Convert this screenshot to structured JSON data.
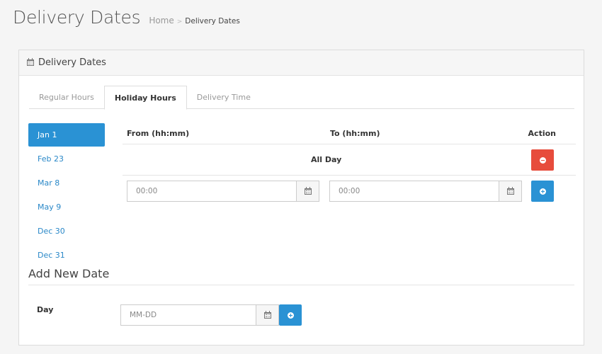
{
  "header": {
    "title": "Delivery Dates",
    "breadcrumb": {
      "home": "Home",
      "separator": ">",
      "current": "Delivery Dates"
    }
  },
  "panel": {
    "title": "Delivery Dates"
  },
  "tabs": [
    {
      "label": "Regular Hours",
      "active": false
    },
    {
      "label": "Holiday Hours",
      "active": true
    },
    {
      "label": "Delivery Time",
      "active": false
    }
  ],
  "dates": [
    "Jan 1",
    "Feb 23",
    "Mar 8",
    "May 9",
    "Dec 30",
    "Dec 31"
  ],
  "selected_date": "Jan 1",
  "hours_table": {
    "headers": {
      "from": "From (hh:mm)",
      "to": "To (hh:mm)",
      "action": "Action"
    },
    "rows": [
      {
        "label": "All Day"
      }
    ],
    "new_row": {
      "from_placeholder": "00:00",
      "to_placeholder": "00:00"
    }
  },
  "add_new_date": {
    "title": "Add New Date",
    "day_label": "Day",
    "day_placeholder": "MM-DD"
  },
  "colors": {
    "accent": "#2a92d4",
    "danger": "#e74c3c",
    "link": "#2a88c8"
  }
}
